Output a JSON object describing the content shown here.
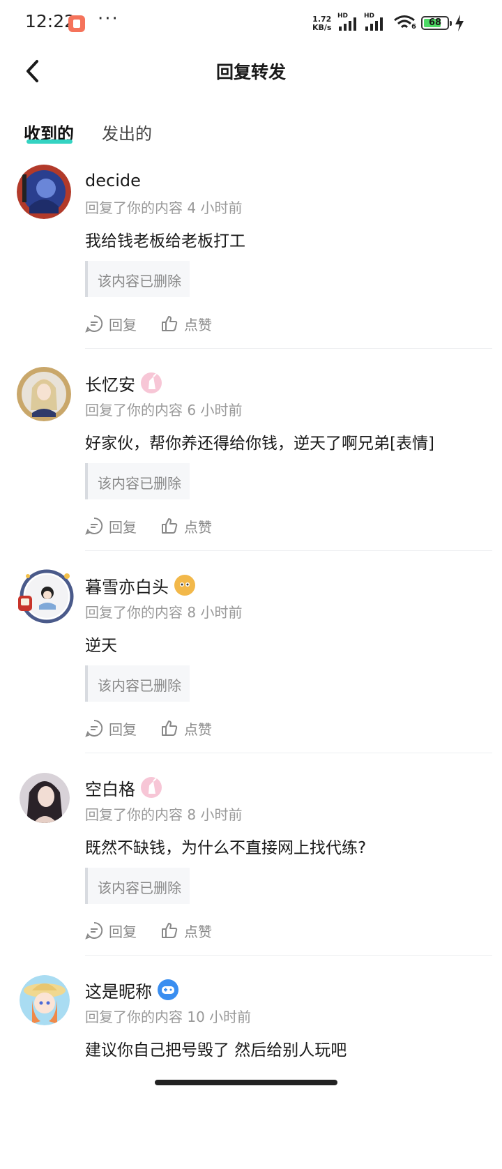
{
  "status_bar": {
    "time": "12:22",
    "more": "···",
    "net_speed_value": "1.72",
    "net_speed_unit": "KB/s",
    "network_label_1": "HD",
    "network_label_2": "HD",
    "wifi_label": "6",
    "battery": "68"
  },
  "header": {
    "title": "回复转发"
  },
  "tabs": [
    {
      "label": "收到的",
      "active": true
    },
    {
      "label": "发出的",
      "active": false
    }
  ],
  "items": [
    {
      "name": "decide",
      "meta": "回复了你的内容 4 小时前",
      "comment": "我给钱老板给老板打工",
      "quote": "该内容已删除",
      "reply": "回复",
      "like": "点赞",
      "avatar_color": "#2a3f8f",
      "badge": "none"
    },
    {
      "name": "长忆安",
      "meta": "回复了你的内容 6 小时前",
      "comment": "好家伙，帮你养还得给你钱，逆天了啊兄弟[表情]",
      "quote": "该内容已删除",
      "reply": "回复",
      "like": "点赞",
      "avatar_color": "#8a7a6a",
      "badge": "pink-unicorn"
    },
    {
      "name": "暮雪亦白头",
      "meta": "回复了你的内容 8 小时前",
      "comment": "逆天",
      "quote": "该内容已删除",
      "reply": "回复",
      "like": "点赞",
      "avatar_color": "#3a4a7a",
      "badge": "orange-egg"
    },
    {
      "name": "空白格",
      "meta": "回复了你的内容 8 小时前",
      "comment": "既然不缺钱，为什么不直接网上找代练?",
      "quote": "该内容已删除",
      "reply": "回复",
      "like": "点赞",
      "avatar_color": "#5a4a5a",
      "badge": "pink-unicorn"
    },
    {
      "name": "这是昵称",
      "meta": "回复了你的内容 10 小时前",
      "comment": "建议你自己把号毁了 然后给别人玩吧",
      "quote": "",
      "reply": "",
      "like": "",
      "avatar_color": "#e9b16a",
      "badge": "blue-gamepad"
    }
  ]
}
